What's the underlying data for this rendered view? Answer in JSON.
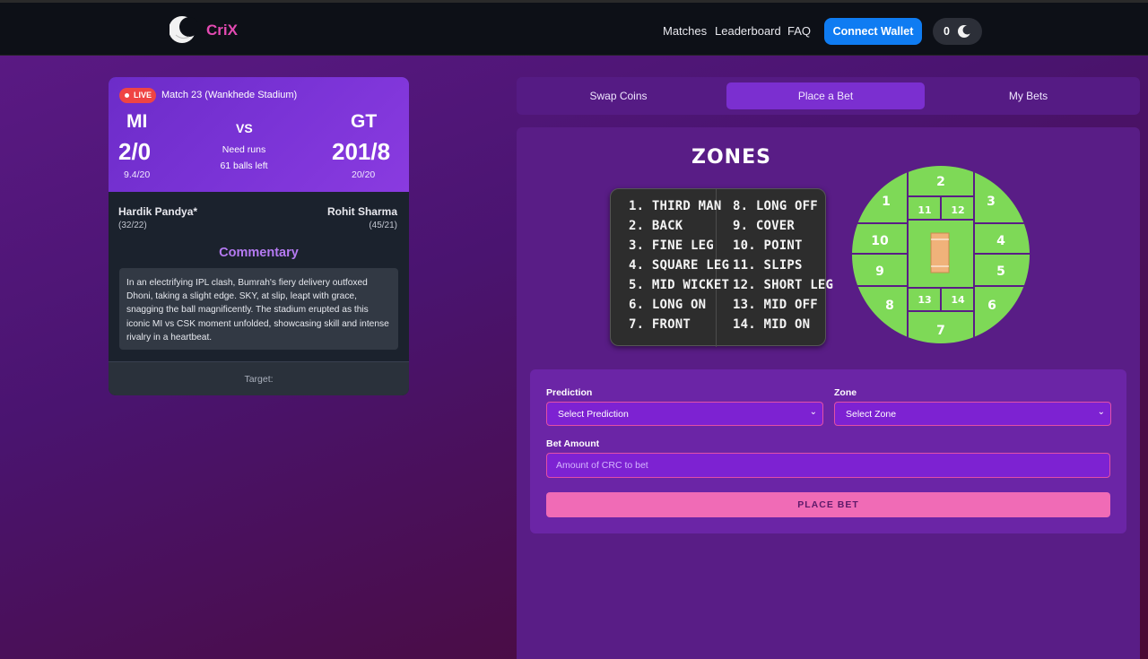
{
  "header": {
    "brand": "CriX",
    "nav": [
      "Matches",
      "Leaderboard",
      "FAQ"
    ],
    "connect_label": "Connect Wallet",
    "balance": "0"
  },
  "match": {
    "live_label": "LIVE",
    "title": "Match 23 (Wankhede Stadium)",
    "team_a": {
      "code": "MI",
      "score": "2/0",
      "overs": "9.4/20"
    },
    "team_b": {
      "code": "GT",
      "score": "201/8",
      "overs": "20/20"
    },
    "vs": "VS",
    "need_label": "Need runs",
    "balls_left": "61 balls left",
    "batsman_a": {
      "name": "Hardik Pandya*",
      "score": "(32/22)"
    },
    "batsman_b": {
      "name": "Rohit Sharma",
      "score": "(45/21)"
    },
    "commentary_title": "Commentary",
    "commentary": "In an electrifying IPL clash, Bumrah's fiery delivery outfoxed Dhoni, taking a slight edge. SKY, at slip, leapt with grace, snagging the ball magnificently. The stadium erupted as this iconic MI vs CSK moment unfolded, showcasing skill and intense rivalry in a heartbeat.",
    "target_label": "Target:"
  },
  "tabs": [
    {
      "label": "Swap Coins",
      "active": false
    },
    {
      "label": "Place a Bet",
      "active": true
    },
    {
      "label": "My Bets",
      "active": false
    }
  ],
  "zones": {
    "title": "ZONES",
    "left": [
      "1. THIRD MAN",
      "2. BACK",
      "3. FINE LEG",
      "4. SQUARE LEG",
      "5. MID WICKET",
      "6. LONG ON",
      "7. FRONT"
    ],
    "right": [
      "8. LONG OFF",
      "9. COVER",
      "10. POINT",
      "11. SLIPS",
      "12. SHORT LEG",
      "13. MID OFF",
      "14. MID ON"
    ],
    "map_numbers": [
      "1",
      "2",
      "3",
      "4",
      "5",
      "6",
      "7",
      "8",
      "9",
      "10",
      "11",
      "12",
      "13",
      "14"
    ],
    "field_color": "#7ed957",
    "pitch_color": "#f0b27a"
  },
  "bet_form": {
    "prediction_label": "Prediction",
    "prediction_value": "Select Prediction",
    "zone_label": "Zone",
    "zone_value": "Select Zone",
    "amount_label": "Bet Amount",
    "amount_placeholder": "Amount of CRC to bet",
    "submit_label": "PLACE BET"
  }
}
